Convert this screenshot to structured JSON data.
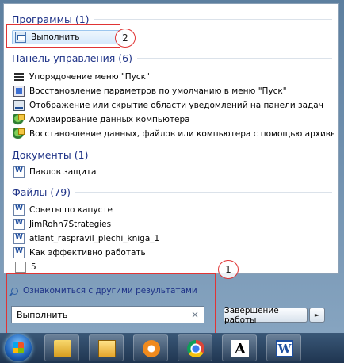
{
  "groups": {
    "programs": {
      "title": "Программы (1)",
      "items": [
        "Выполнить"
      ]
    },
    "control_panel": {
      "title": "Панель управления (6)",
      "items": [
        "Упорядочение меню \"Пуск\"",
        "Восстановление параметров по умолчанию в меню \"Пуск\"",
        "Отображение или скрытие области уведомлений на панели задач",
        "Архивирование данных компьютера",
        "Восстановление данных, файлов или компьютера с помощью архивных ко..."
      ]
    },
    "documents": {
      "title": "Документы (1)",
      "items": [
        "Павлов защита"
      ]
    },
    "files": {
      "title": "Файлы (79)",
      "items": [
        "Советы по капусте",
        "JimRohn7Strategies",
        "atlant_raspravil_plechi_kniga_1",
        "Как эффективно работать",
        "5"
      ]
    }
  },
  "annotations": {
    "marker_1": "1",
    "marker_2": "2",
    "color": "#e03434"
  },
  "bottom": {
    "see_more": "Ознакомиться с другими результатами",
    "search_value": "Выполнить",
    "clear_glyph": "×",
    "shutdown_label": "Завершение работы",
    "shutdown_arrow": "►"
  },
  "taskbar": {
    "icons": [
      "windows-explorer-icon",
      "folder-icon",
      "mail-agent-icon",
      "chrome-icon",
      "font-icon",
      "word-icon"
    ],
    "font_glyph": "A",
    "word_glyph": "W"
  },
  "colors": {
    "header_text": "#1e3287",
    "selection": "#d6e9fb",
    "taskbar": "#1f3550"
  }
}
